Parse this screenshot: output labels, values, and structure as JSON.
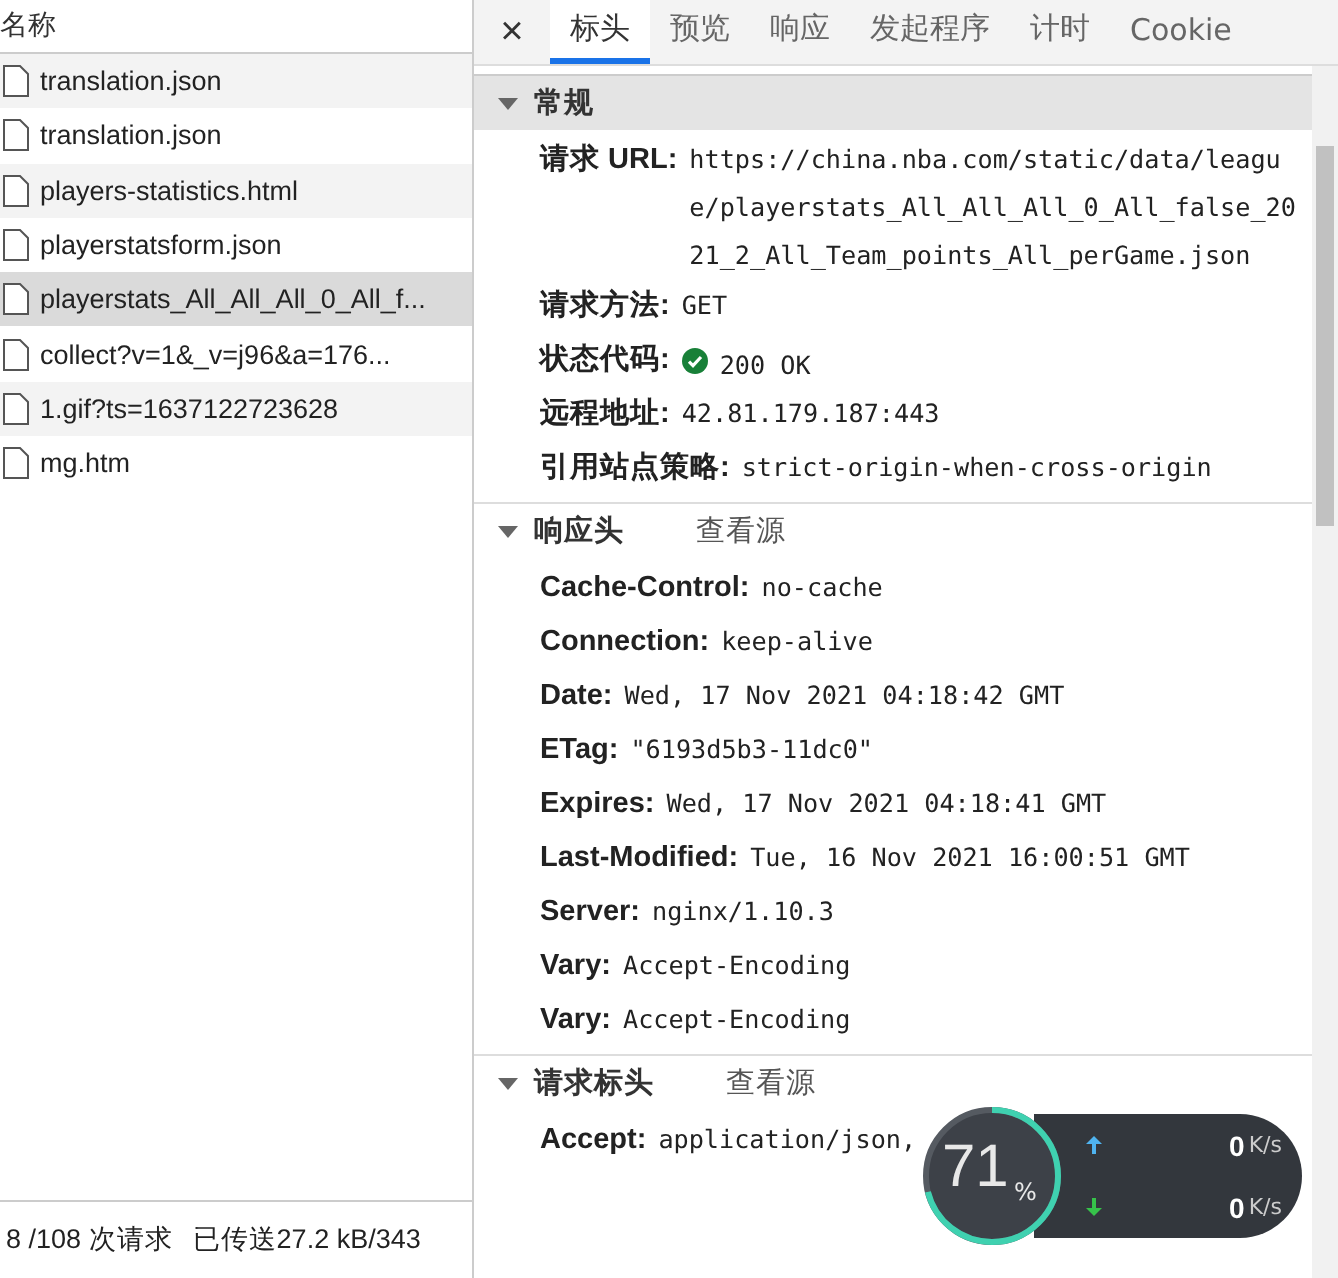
{
  "request_list": {
    "column": "名称",
    "rows": [
      {
        "name": "translation.json",
        "selected": false
      },
      {
        "name": "translation.json",
        "selected": false
      },
      {
        "name": "players-statistics.html",
        "selected": false
      },
      {
        "name": "playerstatsform.json",
        "selected": false
      },
      {
        "name": "playerstats_All_All_All_0_All_f...",
        "selected": true
      },
      {
        "name": "collect?v=1&_v=j96&a=176...",
        "selected": false
      },
      {
        "name": "1.gif?ts=1637122723628",
        "selected": false
      },
      {
        "name": "mg.htm",
        "selected": false
      }
    ]
  },
  "status_bar": {
    "requests": "8 /108 次请求",
    "transferred": "已传送27.2 kB/343"
  },
  "close_label": "×",
  "tabs": [
    {
      "label": "标头",
      "selected": true
    },
    {
      "label": "预览",
      "selected": false
    },
    {
      "label": "响应",
      "selected": false
    },
    {
      "label": "发起程序",
      "selected": false
    },
    {
      "label": "计时",
      "selected": false
    },
    {
      "label": "Cookie",
      "selected": false
    }
  ],
  "sections": [
    {
      "title": "常规",
      "expanded": true,
      "headers": [
        {
          "kind": "text",
          "name": "请求 URL:",
          "value": "https://china.nba.com/static/data/league/playerstats_All_All_All_0_All_false_2021_2_All_Team_points_All_perGame.json"
        },
        {
          "kind": "text",
          "name": "请求方法:",
          "value": "GET"
        },
        {
          "kind": "status",
          "name": "状态代码:",
          "value": "200 OK"
        },
        {
          "kind": "text",
          "name": "远程地址:",
          "value": "42.81.179.187:443"
        },
        {
          "kind": "text",
          "name": "引用站点策略:",
          "value": "strict-origin-when-cross-origin"
        }
      ]
    },
    {
      "title": "响应头",
      "expanded": true,
      "source_link": "查看源",
      "headers": [
        {
          "kind": "text",
          "name": "Cache-Control:",
          "value": "no-cache"
        },
        {
          "kind": "text",
          "name": "Connection:",
          "value": "keep-alive"
        },
        {
          "kind": "text",
          "name": "Date:",
          "value": "Wed, 17 Nov 2021 04:18:42 GMT"
        },
        {
          "kind": "text",
          "name": "ETag:",
          "value": "\"6193d5b3-11dc0\""
        },
        {
          "kind": "text",
          "name": "Expires:",
          "value": "Wed, 17 Nov 2021 04:18:41 GMT"
        },
        {
          "kind": "text",
          "name": "Last-Modified:",
          "value": "Tue, 16 Nov 2021 16:00:51 GMT"
        },
        {
          "kind": "text",
          "name": "Server:",
          "value": "nginx/1.10.3"
        },
        {
          "kind": "text",
          "name": "Vary:",
          "value": "Accept-Encoding"
        },
        {
          "kind": "text",
          "name": "Vary:",
          "value": "Accept-Encoding"
        }
      ]
    },
    {
      "title": "请求标头",
      "expanded": true,
      "source_link": "查看源",
      "headers": [
        {
          "kind": "text",
          "name": "Accept:",
          "value": "application/json,"
        }
      ]
    }
  ],
  "speed_widget": {
    "percent": "71",
    "percent_unit": "%",
    "level": 0.71,
    "upload": "0",
    "upload_unit": "K/s",
    "download": "0",
    "download_unit": "K/s"
  }
}
